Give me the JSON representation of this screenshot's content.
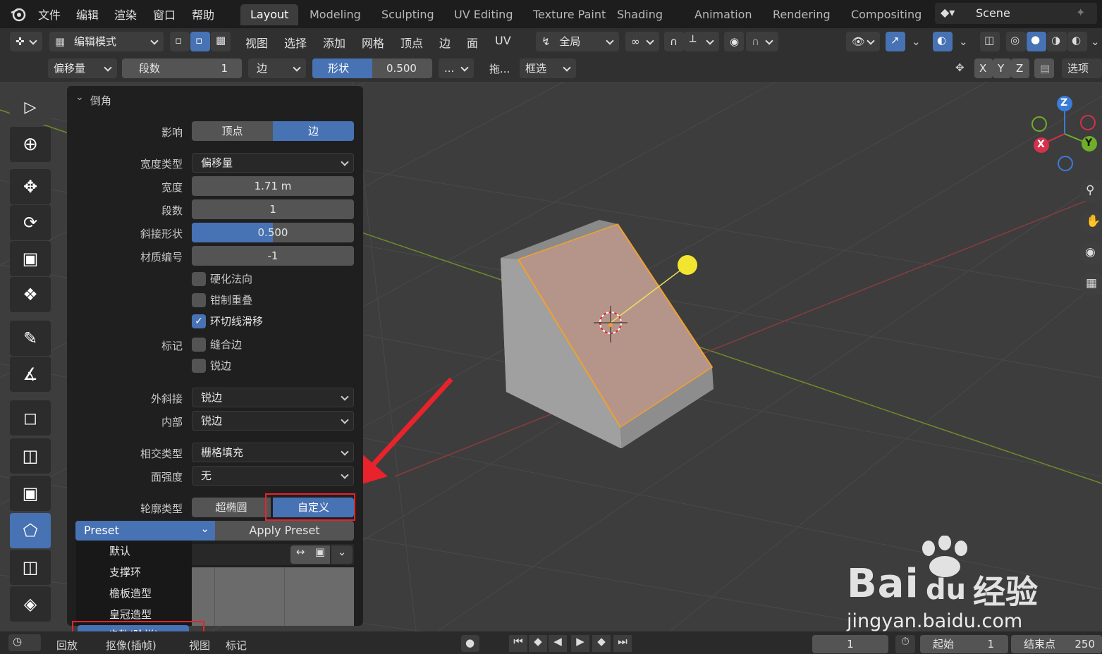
{
  "menu": {
    "file": "文件",
    "edit": "编辑",
    "render": "渲染",
    "window": "窗口",
    "help": "帮助"
  },
  "workspaces": [
    "Layout",
    "Modeling",
    "Sculpting",
    "UV Editing",
    "Texture Paint",
    "Shading",
    "Animation",
    "Rendering",
    "Compositing"
  ],
  "scene": {
    "name": "Scene"
  },
  "header": {
    "mode": "编辑模式",
    "view": "视图",
    "select": "选择",
    "add": "添加",
    "mesh": "网格",
    "vertex": "顶点",
    "edge": "边",
    "face": "面",
    "uv": "UV",
    "transform_orientation": "全局"
  },
  "toolheader": {
    "width_type": "偏移量",
    "segments_label": "段数",
    "segments_value": "1",
    "affect": "边",
    "shape_label": "形状",
    "shape_value": "0.500",
    "more": "...",
    "drag": "拖...",
    "box_select": "框选",
    "axis_x": "X",
    "axis_y": "Y",
    "axis_z": "Z",
    "options": "选项"
  },
  "gizmo": {
    "z": "Z",
    "y": "Y",
    "x": "X"
  },
  "panel": {
    "title": "倒角",
    "affect_label": "影响",
    "affect_vertices": "顶点",
    "affect_edges": "边",
    "width_type_label": "宽度类型",
    "width_type": "偏移量",
    "width_label": "宽度",
    "width": "1.71 m",
    "segments_label": "段数",
    "segments": "1",
    "shape_label": "斜接形状",
    "shape": "0.500",
    "shape_fraction": 0.5,
    "material_label": "材质编号",
    "material": "-1",
    "harden_normals": "硬化法向",
    "clamp_overlap": "钳制重叠",
    "loop_slide": "环切线滑移",
    "mark_label": "标记",
    "mark_seam": "缝合边",
    "mark_sharp": "锐边",
    "miter_outer_label": "外斜接",
    "miter_outer": "锐边",
    "miter_inner_label": "内部",
    "miter_inner": "锐边",
    "intersection_label": "相交类型",
    "intersection": "栅格填充",
    "face_strength_label": "面强度",
    "face_strength": "无",
    "profile_type_label": "轮廓类型",
    "profile_superellipse": "超椭圆",
    "profile_custom": "自定义",
    "preset": "Preset",
    "apply_preset": "Apply Preset",
    "preset_items": [
      "默认",
      "支撑环",
      "檐板造型",
      "皇冠造型",
      "步数(阶梯)"
    ]
  },
  "timeline": {
    "playback": "回放",
    "keying": "抠像(插帧)",
    "view": "视图",
    "marker": "标记",
    "current_frame": "1",
    "start_label": "起始",
    "start": "1",
    "end_label": "结束点",
    "end": "250"
  },
  "watermark": {
    "site": "jingyan.baidu.com",
    "brand": "经验"
  },
  "colors": {
    "accent": "#4772b3",
    "panel": "#1f1f1f",
    "viewport": "#3d3d3d",
    "highlight_red": "#e8232b",
    "selected_edge": "#f0a030",
    "light": "#f2e530"
  }
}
